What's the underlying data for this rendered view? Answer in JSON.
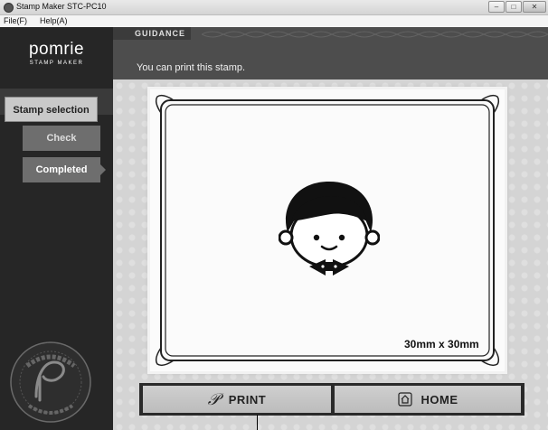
{
  "window": {
    "title": "Stamp Maker STC-PC10",
    "minimize": "–",
    "maximize": "□",
    "close": "✕"
  },
  "menu": {
    "file": "File(F)",
    "help": "Help(A)"
  },
  "logo": {
    "main": "pomrie",
    "sub": "STAMP MAKER"
  },
  "sidebar": {
    "items": [
      {
        "label": "Stamp selection"
      },
      {
        "label": "Check"
      },
      {
        "label": "Completed"
      }
    ]
  },
  "guidance": {
    "label": "GUIDANCE",
    "text": "You can print this stamp."
  },
  "stamp": {
    "size_label": "30mm x 30mm",
    "icon": "boy-with-bowtie"
  },
  "actions": {
    "print_label": "PRINT",
    "home_label": "HOME"
  },
  "seal": {
    "text": "STAMP MAKER",
    "bottom_text": "Pomrie",
    "letter": "P"
  },
  "colors": {
    "sidebar": "#262626",
    "guidance": "#4d4d4d",
    "button": "#c9c9c9",
    "background": "#d4d4d4"
  }
}
